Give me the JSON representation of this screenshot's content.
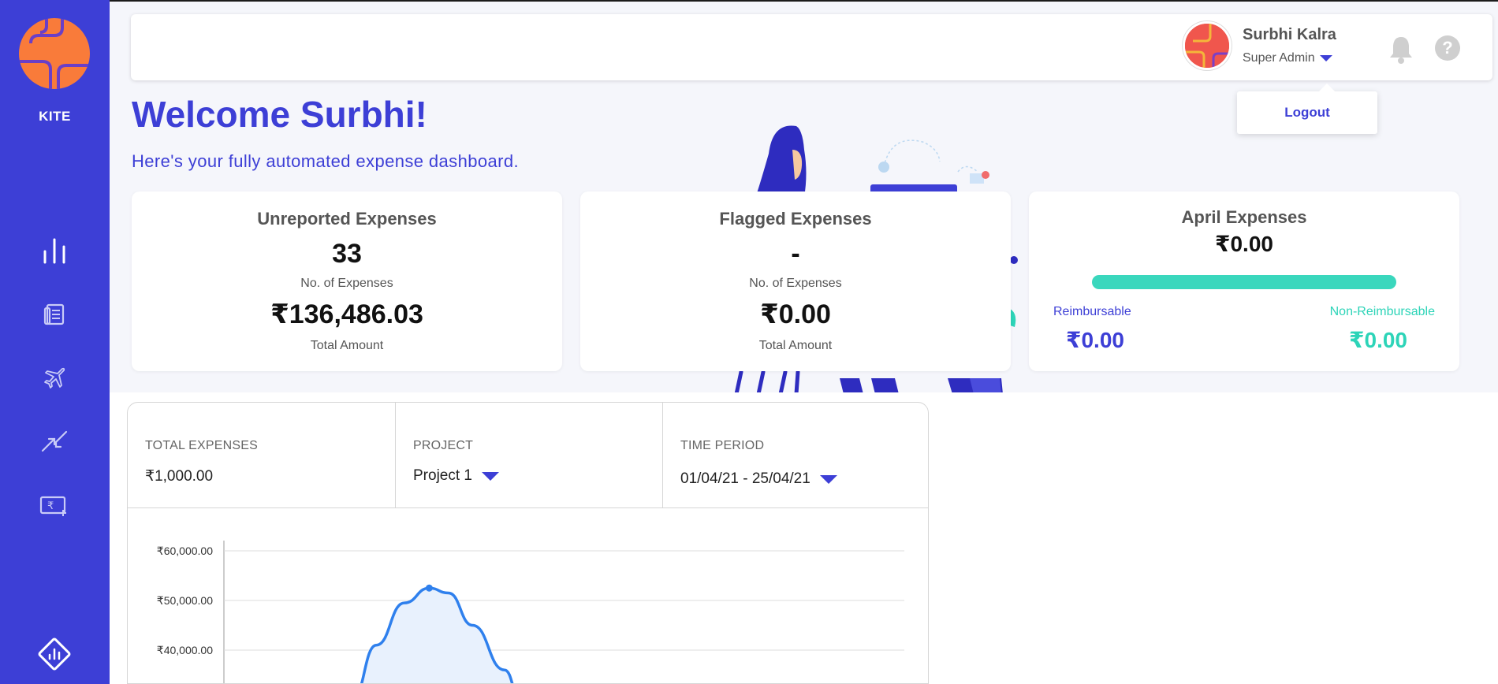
{
  "sidebar": {
    "brand": "KITE",
    "icons": [
      "bar-chart-icon",
      "receipt-icon",
      "airplane-icon",
      "transfer-arrows-icon",
      "add-cash-icon"
    ],
    "bottom_icon": "logo-diamond-icon",
    "color": "#3d3fd6"
  },
  "header": {
    "user_name": "Surbhi Kalra",
    "user_role": "Super Admin",
    "logout_label": "Logout",
    "help_glyph": "?"
  },
  "welcome": {
    "title": "Welcome Surbhi!",
    "subtitle": "Here's your fully automated expense dashboard."
  },
  "cards": {
    "unreported": {
      "title": "Unreported Expenses",
      "count": "33",
      "count_label": "No. of Expenses",
      "amount": "₹136,486.03",
      "amount_label": "Total Amount"
    },
    "flagged": {
      "title": "Flagged Expenses",
      "count": "-",
      "count_label": "No. of Expenses",
      "amount": "₹0.00",
      "amount_label": "Total Amount"
    },
    "april": {
      "title": "April Expenses",
      "amount": "₹0.00",
      "reimbursable_label": "Reimbursable",
      "reimbursable_amount": "₹0.00",
      "non_reimbursable_label": "Non-Reimbursable",
      "non_reimbursable_amount": "₹0.00",
      "bar_color": "#3ad7bd"
    }
  },
  "filters": {
    "total_label": "TOTAL EXPENSES",
    "total_value": "₹1,000.00",
    "project_label": "PROJECT",
    "project_value": "Project 1",
    "period_label": "TIME PERIOD",
    "period_value": "01/04/21 - 25/04/21"
  },
  "chart_data": {
    "type": "area",
    "y_ticks": [
      "₹60,000.00",
      "₹50,000.00",
      "₹40,000.00"
    ],
    "y_tick_values": [
      60000,
      50000,
      40000
    ],
    "series": [
      {
        "points": [
          [
            0.28,
            30000
          ],
          [
            0.31,
            41000
          ],
          [
            0.345,
            49500
          ],
          [
            0.376,
            52500
          ],
          [
            0.4,
            51500
          ],
          [
            0.43,
            45000
          ],
          [
            0.47,
            36000
          ],
          [
            0.49,
            30000
          ]
        ]
      }
    ],
    "peak_marker": [
      0.376,
      52500
    ],
    "line_color": "#2f80ed",
    "fill_color": "#e8f1fd"
  }
}
